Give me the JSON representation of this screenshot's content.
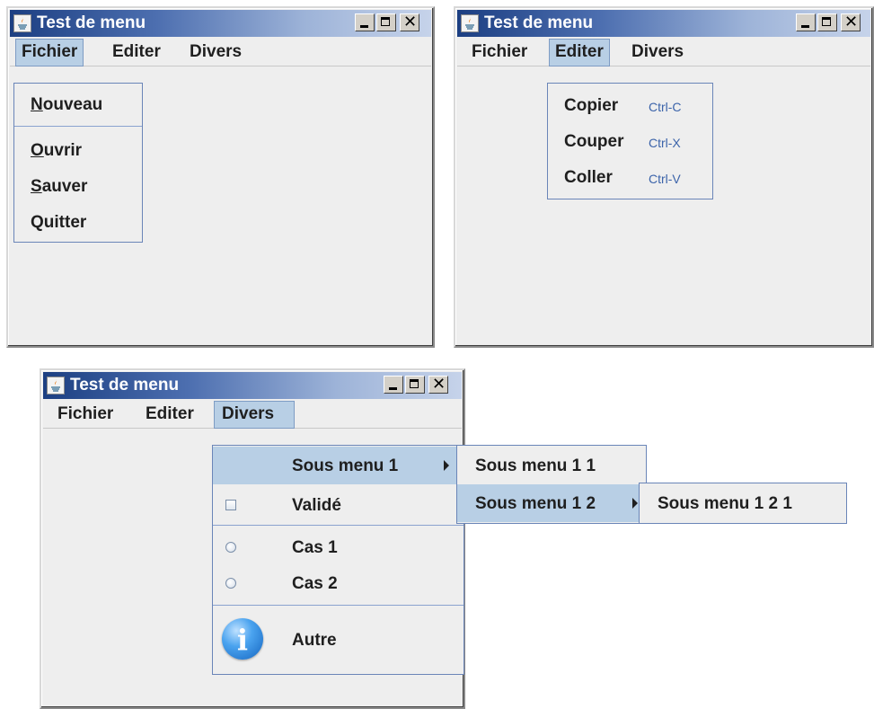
{
  "title": "Test de menu",
  "menubar": {
    "fichier": "Fichier",
    "editer": "Editer",
    "divers": "Divers"
  },
  "fichier_menu": [
    {
      "label": "Nouveau",
      "mnemonic": "N",
      "rest": "ouveau"
    },
    {
      "label": "Ouvrir",
      "mnemonic": "O",
      "rest": "uvrir"
    },
    {
      "label": "Sauver",
      "mnemonic": "S",
      "rest": "auver"
    },
    {
      "label": "Quitter"
    }
  ],
  "editer_menu": [
    {
      "label": "Copier",
      "accel": "Ctrl-C"
    },
    {
      "label": "Couper",
      "accel": "Ctrl-X"
    },
    {
      "label": "Coller",
      "accel": "Ctrl-V"
    }
  ],
  "divers_menu": {
    "sous_menu_1": "Sous menu 1",
    "valide": "Validé",
    "cas1": "Cas 1",
    "cas2": "Cas 2",
    "autre": "Autre",
    "submenu": {
      "item1": "Sous menu 1 1",
      "item2": "Sous menu 1 2"
    },
    "subsubmenu": {
      "item1": "Sous menu 1 2 1"
    }
  },
  "colors": {
    "title_gradient_start": "#1c3f82",
    "title_gradient_end": "#c6d3ea",
    "highlight": "#b8cfe5",
    "popup_border": "#6a85b8",
    "accelerator": "#3c64aa"
  }
}
